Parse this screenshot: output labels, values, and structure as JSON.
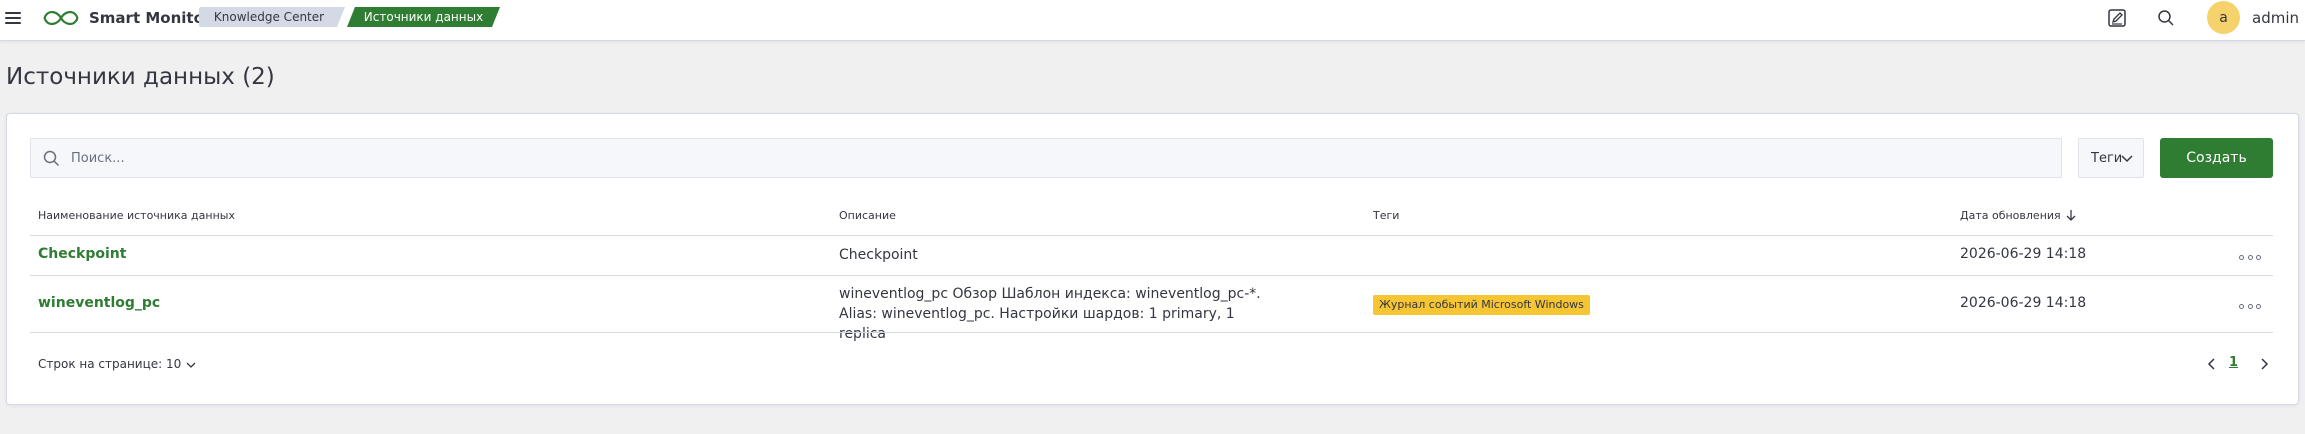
{
  "header": {
    "app_name": "Smart Monitor",
    "breadcrumbs": [
      "Knowledge Center",
      "Источники данных"
    ],
    "user_initial": "a",
    "username": "admin"
  },
  "page": {
    "title": "Источники данных (2)"
  },
  "search": {
    "placeholder": "Поиск...",
    "value": ""
  },
  "filters": {
    "tags_label": "Теги"
  },
  "actions": {
    "create_label": "Создать"
  },
  "table": {
    "columns": [
      "Наименование источника данных",
      "Описание",
      "Теги",
      "Дата обновления"
    ],
    "rows": [
      {
        "name": "Checkpoint",
        "description": "Checkpoint",
        "tags": [],
        "updated": "2026-06-29 14:18"
      },
      {
        "name": "wineventlog_pc",
        "description": "wineventlog_pc Обзор Шаблон индекса: wineventlog_pc-*. Alias: wineventlog_pc. Настройки шардов: 1 primary, 1 replica",
        "tags": [
          "Журнал событий Microsoft Windows"
        ],
        "updated": "2026-06-29 14:18"
      }
    ]
  },
  "pagination": {
    "rows_per_page": "Строк на странице: 10",
    "current_page": "1"
  },
  "colors": {
    "accent": "#2e7d32",
    "tag_badge": "#f5c533",
    "avatar": "#f5d36a"
  },
  "icons": [
    "menu-icon",
    "logo-icon",
    "notes-icon",
    "search-icon",
    "chevron-down-icon",
    "arrow-down-icon",
    "more-icon",
    "chevron-left-icon",
    "chevron-right-icon"
  ]
}
